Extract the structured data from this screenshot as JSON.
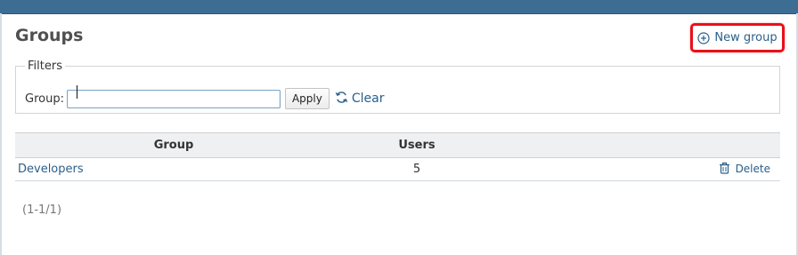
{
  "header": {
    "title": "Groups",
    "new_group_label": "New group"
  },
  "filters": {
    "legend": "Filters",
    "group_label": "Group:",
    "group_value": "",
    "apply_label": "Apply",
    "clear_label": "Clear"
  },
  "table": {
    "columns": [
      "Group",
      "Users",
      ""
    ],
    "rows": [
      {
        "group": "Developers",
        "users": "5",
        "action": "Delete"
      }
    ]
  },
  "pager": {
    "text": "(1-1/1)"
  },
  "colors": {
    "topbar": "#3e6d94",
    "link": "#2a5f8a",
    "highlight": "#e8101a"
  },
  "icons": {
    "new_group": "plus-circle-icon",
    "clear": "refresh-icon",
    "delete": "trash-icon"
  }
}
